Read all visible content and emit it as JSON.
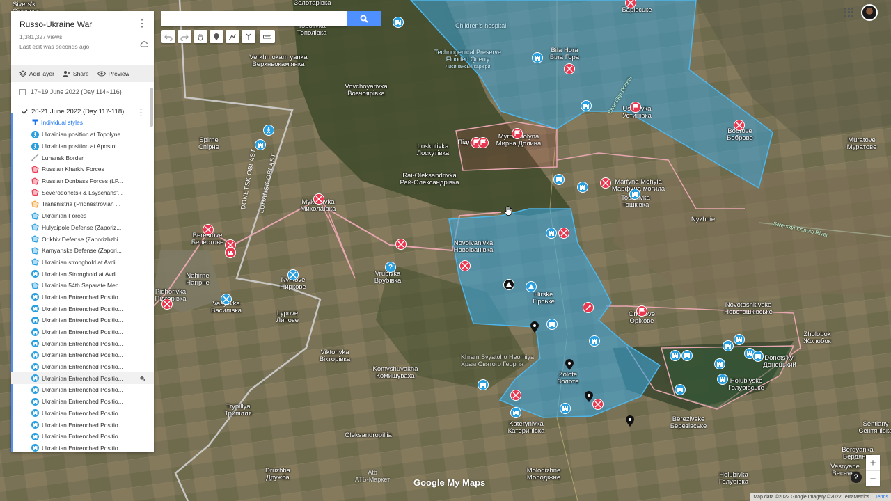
{
  "panel": {
    "title": "Russo-Ukraine War",
    "views": "1,381,327 views",
    "last_edit": "Last edit was seconds ago",
    "actions": {
      "add_layer": "Add layer",
      "share": "Share",
      "preview": "Preview"
    },
    "layer_prev": "17~19 June 2022 (Day 114~116)",
    "layer_active": "20-21 June 2022 (Day 117-118)",
    "styles_label": "Individual styles",
    "items": [
      {
        "label": "Ukrainian position at Topolyne",
        "icon": "walking-person-icon",
        "color": "#2a9fe0"
      },
      {
        "label": "Ukrainian position at Apostol...",
        "icon": "walking-person-icon",
        "color": "#2a9fe0"
      },
      {
        "label": "Luhansk Border",
        "icon": "line-icon",
        "color": "#9e9e9e"
      },
      {
        "label": "Russian Kharkiv Forces",
        "icon": "polygon-icon",
        "color": "#e8374f"
      },
      {
        "label": "Russian Donbass Forces (LP...",
        "icon": "polygon-icon",
        "color": "#e8374f"
      },
      {
        "label": "Severodonetsk & Lsyschans'...",
        "icon": "polygon-icon",
        "color": "#e8374f"
      },
      {
        "label": "Transnistria (Pridnestrovian ...",
        "icon": "polygon-icon",
        "color": "#f4a43a"
      },
      {
        "label": "Ukrainian Forces",
        "icon": "polygon-icon",
        "color": "#2a9fe0"
      },
      {
        "label": "Hulyaipole Defense (Zaporiz...",
        "icon": "polygon-icon",
        "color": "#2a9fe0"
      },
      {
        "label": "Orikhiv Defense (Zaporizhzhi...",
        "icon": "polygon-icon",
        "color": "#2a9fe0"
      },
      {
        "label": "Kamyanske Defense (Zapori...",
        "icon": "polygon-icon",
        "color": "#2a9fe0"
      },
      {
        "label": "Ukrainian stronghold at Avdi...",
        "icon": "polygon-icon",
        "color": "#2a9fe0"
      },
      {
        "label": "Ukrainian Stronghold at Avdi...",
        "icon": "castle-icon",
        "color": "#2a9fe0"
      },
      {
        "label": "Ukrainian 54th Separate Mec...",
        "icon": "polygon-icon",
        "color": "#2a9fe0"
      },
      {
        "label": "Ukrainian Entrenched Positio...",
        "icon": "castle-icon",
        "color": "#2a9fe0"
      },
      {
        "label": "Ukrainian Entrenched Positio...",
        "icon": "castle-icon",
        "color": "#2a9fe0"
      },
      {
        "label": "Ukrainian Entrenched Positio...",
        "icon": "castle-icon",
        "color": "#2a9fe0"
      },
      {
        "label": "Ukrainian Entrenched Positio...",
        "icon": "castle-icon",
        "color": "#2a9fe0"
      },
      {
        "label": "Ukrainian Entrenched Positio...",
        "icon": "castle-icon",
        "color": "#2a9fe0"
      },
      {
        "label": "Ukrainian Entrenched Positio...",
        "icon": "castle-icon",
        "color": "#2a9fe0"
      },
      {
        "label": "Ukrainian Entrenched Positio...",
        "icon": "castle-icon",
        "color": "#2a9fe0"
      },
      {
        "label": "Ukrainian Entrenched Positio...",
        "icon": "castle-icon",
        "color": "#2a9fe0",
        "highlight": true
      },
      {
        "label": "Ukrainian Entrenched Positio...",
        "icon": "castle-icon",
        "color": "#2a9fe0"
      },
      {
        "label": "Ukrainian Entrenched Positio...",
        "icon": "castle-icon",
        "color": "#2a9fe0"
      },
      {
        "label": "Ukrainian Entrenched Positio...",
        "icon": "castle-icon",
        "color": "#2a9fe0"
      },
      {
        "label": "Ukrainian Entrenched Positio...",
        "icon": "castle-icon",
        "color": "#2a9fe0"
      },
      {
        "label": "Ukrainian Entrenched Positio...",
        "icon": "castle-icon",
        "color": "#2a9fe0"
      },
      {
        "label": "Ukrainian Entrenched Positio...",
        "icon": "castle-icon",
        "color": "#2a9fe0"
      }
    ]
  },
  "search": {
    "placeholder": ""
  },
  "map": {
    "colors": {
      "russian": "#e8374f",
      "ukrainian": "#2a9fe0",
      "ukr_fill": "#3aa3d8"
    },
    "places": [
      {
        "lat": "Sivers'k",
        "cyr": "Сіверськ"
      },
      {
        "lat": "Zolotarivka",
        "cyr": "Золотарівка"
      },
      {
        "lat": "Topolivka",
        "cyr": "Тополівка"
      },
      {
        "lat": "Verkhn okam yanka",
        "cyr": "Верхньокам'янка"
      },
      {
        "lat": "Vovchoyarivka",
        "cyr": "Вовчоярівка"
      },
      {
        "lat": "Spirne",
        "cyr": "Спірне"
      },
      {
        "lat": "Loskutivka",
        "cyr": "Лоскутівка"
      },
      {
        "lat": "Rai-Oleksandrivka",
        "cyr": "Рай-Олександрівка"
      },
      {
        "lat": "Myrna Dolyna",
        "cyr": "Мирна Долина"
      },
      {
        "lat": "Pidlisne",
        "cyr": "Підлісне"
      },
      {
        "lat": "Bila Hora",
        "cyr": "Біла Гора"
      },
      {
        "lat": "Bortivske",
        "cyr": "Барівське"
      },
      {
        "lat": "Ustynivka",
        "cyr": "Устинівка"
      },
      {
        "lat": "Bobrove",
        "cyr": "Боброве"
      },
      {
        "lat": "Muratove",
        "cyr": "Муратове"
      },
      {
        "lat": "Marfyna Mohyla",
        "cyr": "Марфина могила"
      },
      {
        "lat": "Toshkivka",
        "cyr": "Тошківка"
      },
      {
        "lat": "Nyzhnie",
        "cyr": ""
      },
      {
        "lat": "Mykolaivka",
        "cyr": "Миколаївка"
      },
      {
        "lat": "Berestove",
        "cyr": "Берестове"
      },
      {
        "lat": "Novoivanivka",
        "cyr": "Новоіванівка"
      },
      {
        "lat": "Vrubivka",
        "cyr": "Врубівка"
      },
      {
        "lat": "Nyrkove",
        "cyr": "Ниркове"
      },
      {
        "lat": "Nahirne",
        "cyr": "Нагірне"
      },
      {
        "lat": "Vasylivka",
        "cyr": "Василівка"
      },
      {
        "lat": "Hirske",
        "cyr": "Гірське"
      },
      {
        "lat": "Orikhove",
        "cyr": "Оріхове"
      },
      {
        "lat": "Novotoshkivske",
        "cyr": "Новотошківське"
      },
      {
        "lat": "Zholobok",
        "cyr": "Жолобок"
      },
      {
        "lat": "Lypove",
        "cyr": "Липове"
      },
      {
        "lat": "Viktorivka",
        "cyr": "Вікторівка"
      },
      {
        "lat": "Komyshuvakha",
        "cyr": "Комишуваха"
      },
      {
        "lat": "Zolote",
        "cyr": "Золоте"
      },
      {
        "lat": "Donets'kyi",
        "cyr": "Донецький"
      },
      {
        "lat": "Holubivske",
        "cyr": "Голубівське"
      },
      {
        "lat": "Katerynivka",
        "cyr": "Катеринівка"
      },
      {
        "lat": "Berezivske",
        "cyr": "Березівське"
      },
      {
        "lat": "Trypillya",
        "cyr": "Трипілля"
      },
      {
        "lat": "Oleksandropillia",
        "cyr": ""
      },
      {
        "lat": "Druzhba",
        "cyr": "Дружба"
      },
      {
        "lat": "Molodizhne",
        "cyr": "Молодіжне"
      },
      {
        "lat": "Sentiany",
        "cyr": "Сентянівка"
      },
      {
        "lat": "Berdyanka",
        "cyr": "Бердянка"
      },
      {
        "lat": "Vesnyane",
        "cyr": "Весняне"
      },
      {
        "lat": "Holubivka",
        "cyr": "Голубівка"
      },
      {
        "lat": "Zolote",
        "cyr": "Золоте"
      },
      {
        "lat": "Pidhorivka",
        "cyr": "Підгорівка"
      }
    ],
    "pois": {
      "hospital": "Children's hospital",
      "quarry": "Technogenical Preserve Flooded Querry",
      "quarry_cyr": "Лисичанські кар'єри",
      "church": "Khram Svyatoho Heorhiya",
      "church_cyr": "Храм Святого Георгія",
      "atb": "Atb",
      "atb_cyr": "АТБ-Маркет"
    },
    "oblast_labels": {
      "donetsk": "DONETSK OBLAST",
      "luhansk": "LUHANSK OBLAST"
    },
    "river": "Siverskyi Donets River",
    "river2": "Sivers'kyi Donets",
    "logo": "Google My Maps"
  },
  "attribution": {
    "text": "Map data ©2022 Google Imagery ©2022 TerraMetrics",
    "terms": "Terms"
  },
  "zoom": {
    "plus": "+",
    "minus": "−"
  },
  "help": "?"
}
